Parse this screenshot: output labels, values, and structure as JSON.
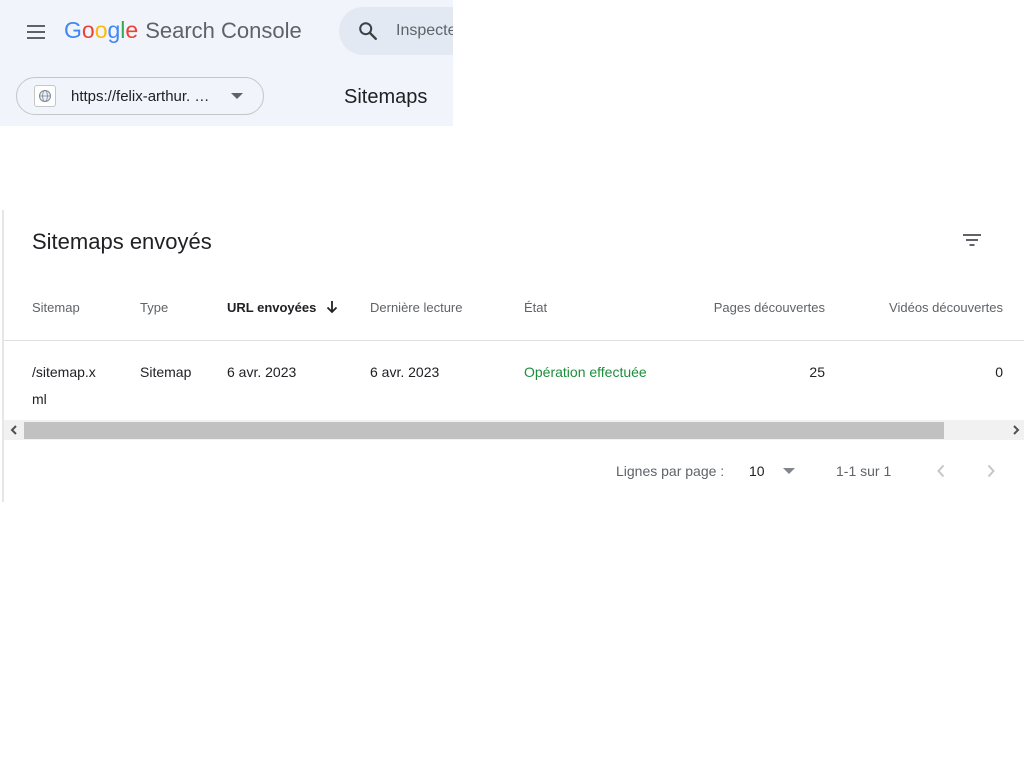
{
  "header": {
    "logo": {
      "g1": "G",
      "o1": "o",
      "o2": "o",
      "g2": "g",
      "l": "l",
      "e": "e",
      "product": "Search Console"
    },
    "search": {
      "placeholder": "Inspecter"
    },
    "property": {
      "label": "https://felix-arthur. …"
    },
    "page_title": "Sitemaps"
  },
  "colors": {
    "google_blue": "#4285f4",
    "google_red": "#ea4335",
    "google_yellow": "#fbbc05",
    "google_green": "#34a853",
    "status_success": "#1e8e3e",
    "header_bg": "#f1f5fb"
  },
  "card": {
    "title": "Sitemaps envoyés",
    "filter_icon": "filter-list-icon",
    "table": {
      "columns": [
        {
          "label": "Sitemap"
        },
        {
          "label": "Type"
        },
        {
          "label": "URL envoyées",
          "sorted": "desc"
        },
        {
          "label": "Dernière lecture"
        },
        {
          "label": "État"
        },
        {
          "label": "Pages découvertes"
        },
        {
          "label": "Vidéos découvertes"
        }
      ],
      "rows": [
        {
          "sitemap": "/sitemap.x ml",
          "sitemap_line1": "/sitemap.x",
          "sitemap_line2": "ml",
          "type": "Sitemap",
          "url_envoyees": "6 avr. 2023",
          "derniere_lecture": "6 avr. 2023",
          "etat": "Opération effectuée",
          "pages_decouvertes": "25",
          "videos_decouvertes": "0"
        }
      ]
    },
    "pagination": {
      "rows_per_page_label": "Lignes par page :",
      "rows_per_page_value": "10",
      "range": "1-1 sur 1"
    }
  }
}
